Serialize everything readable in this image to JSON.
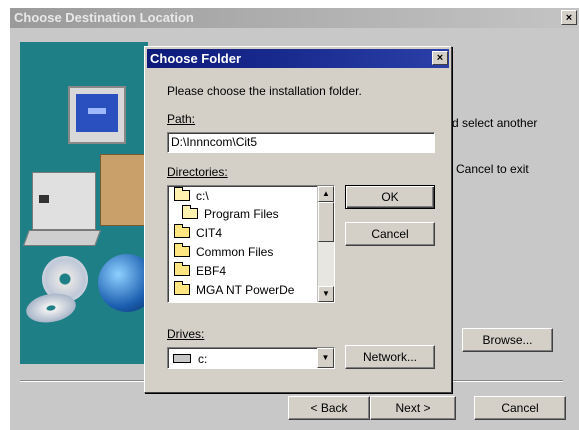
{
  "outer_window": {
    "title": "Choose Destination Location",
    "close_label": "×",
    "text_select_another": "d select another",
    "text_cancel_exit": "Cancel to exit",
    "browse_label": "Browse...",
    "back_label": "< Back",
    "next_label": "Next >",
    "cancel_label": "Cancel"
  },
  "dialog": {
    "title": "Choose Folder",
    "close_label": "×",
    "instruction": "Please choose the installation folder.",
    "path_label": "Path:",
    "path_value": "D:\\Innncom\\Cit5",
    "directories_label": "Directories:",
    "directories": [
      {
        "name": "c:\\",
        "icon": "open-folder-icon"
      },
      {
        "name": "Program Files",
        "icon": "open-folder-icon"
      },
      {
        "name": "CIT4",
        "icon": "folder-icon"
      },
      {
        "name": "Common Files",
        "icon": "folder-icon"
      },
      {
        "name": "EBF4",
        "icon": "folder-icon"
      },
      {
        "name": "MGA NT PowerDe",
        "icon": "folder-icon"
      }
    ],
    "drives_label": "Drives:",
    "drive_value": "c:",
    "ok_label": "OK",
    "cancel_label": "Cancel",
    "network_label": "Network..."
  },
  "colors": {
    "dialog_titlebar": "#0c1a7a",
    "face": "#d4d0c8",
    "art_bg": "#1f7f86"
  }
}
